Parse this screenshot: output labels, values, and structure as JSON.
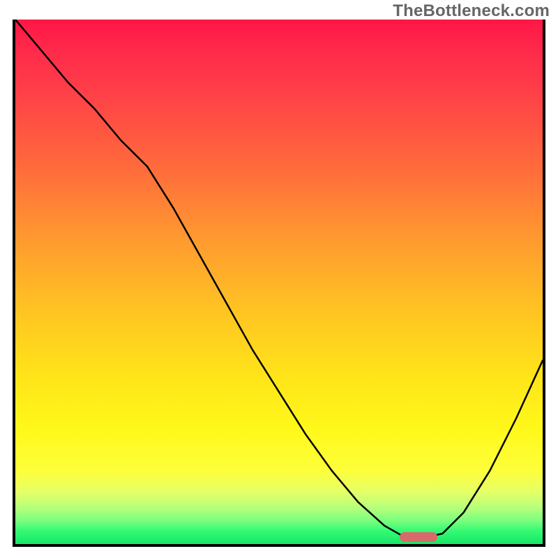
{
  "watermark": "TheBottleneck.com",
  "chart_data": {
    "type": "line",
    "title": "",
    "xlabel": "",
    "ylabel": "",
    "xlim": [
      0,
      1
    ],
    "ylim": [
      0,
      1
    ],
    "series": [
      {
        "name": "bottleneck-curve",
        "x": [
          0.0,
          0.05,
          0.1,
          0.15,
          0.2,
          0.25,
          0.3,
          0.35,
          0.4,
          0.45,
          0.5,
          0.55,
          0.6,
          0.65,
          0.7,
          0.735,
          0.75,
          0.78,
          0.81,
          0.85,
          0.9,
          0.95,
          1.0
        ],
        "y": [
          1.0,
          0.94,
          0.88,
          0.83,
          0.77,
          0.72,
          0.64,
          0.55,
          0.46,
          0.37,
          0.29,
          0.21,
          0.14,
          0.08,
          0.035,
          0.015,
          0.013,
          0.013,
          0.02,
          0.06,
          0.14,
          0.24,
          0.35
        ]
      }
    ],
    "annotations": [
      {
        "name": "min-marker",
        "x": 0.765,
        "y": 0.013
      }
    ],
    "background_gradient": {
      "stops": [
        {
          "pos": 0.0,
          "color": "#ff1646"
        },
        {
          "pos": 0.28,
          "color": "#ff6a3c"
        },
        {
          "pos": 0.56,
          "color": "#ffc522"
        },
        {
          "pos": 0.78,
          "color": "#fff81a"
        },
        {
          "pos": 0.93,
          "color": "#b8ff7a"
        },
        {
          "pos": 1.0,
          "color": "#17e768"
        }
      ]
    }
  }
}
